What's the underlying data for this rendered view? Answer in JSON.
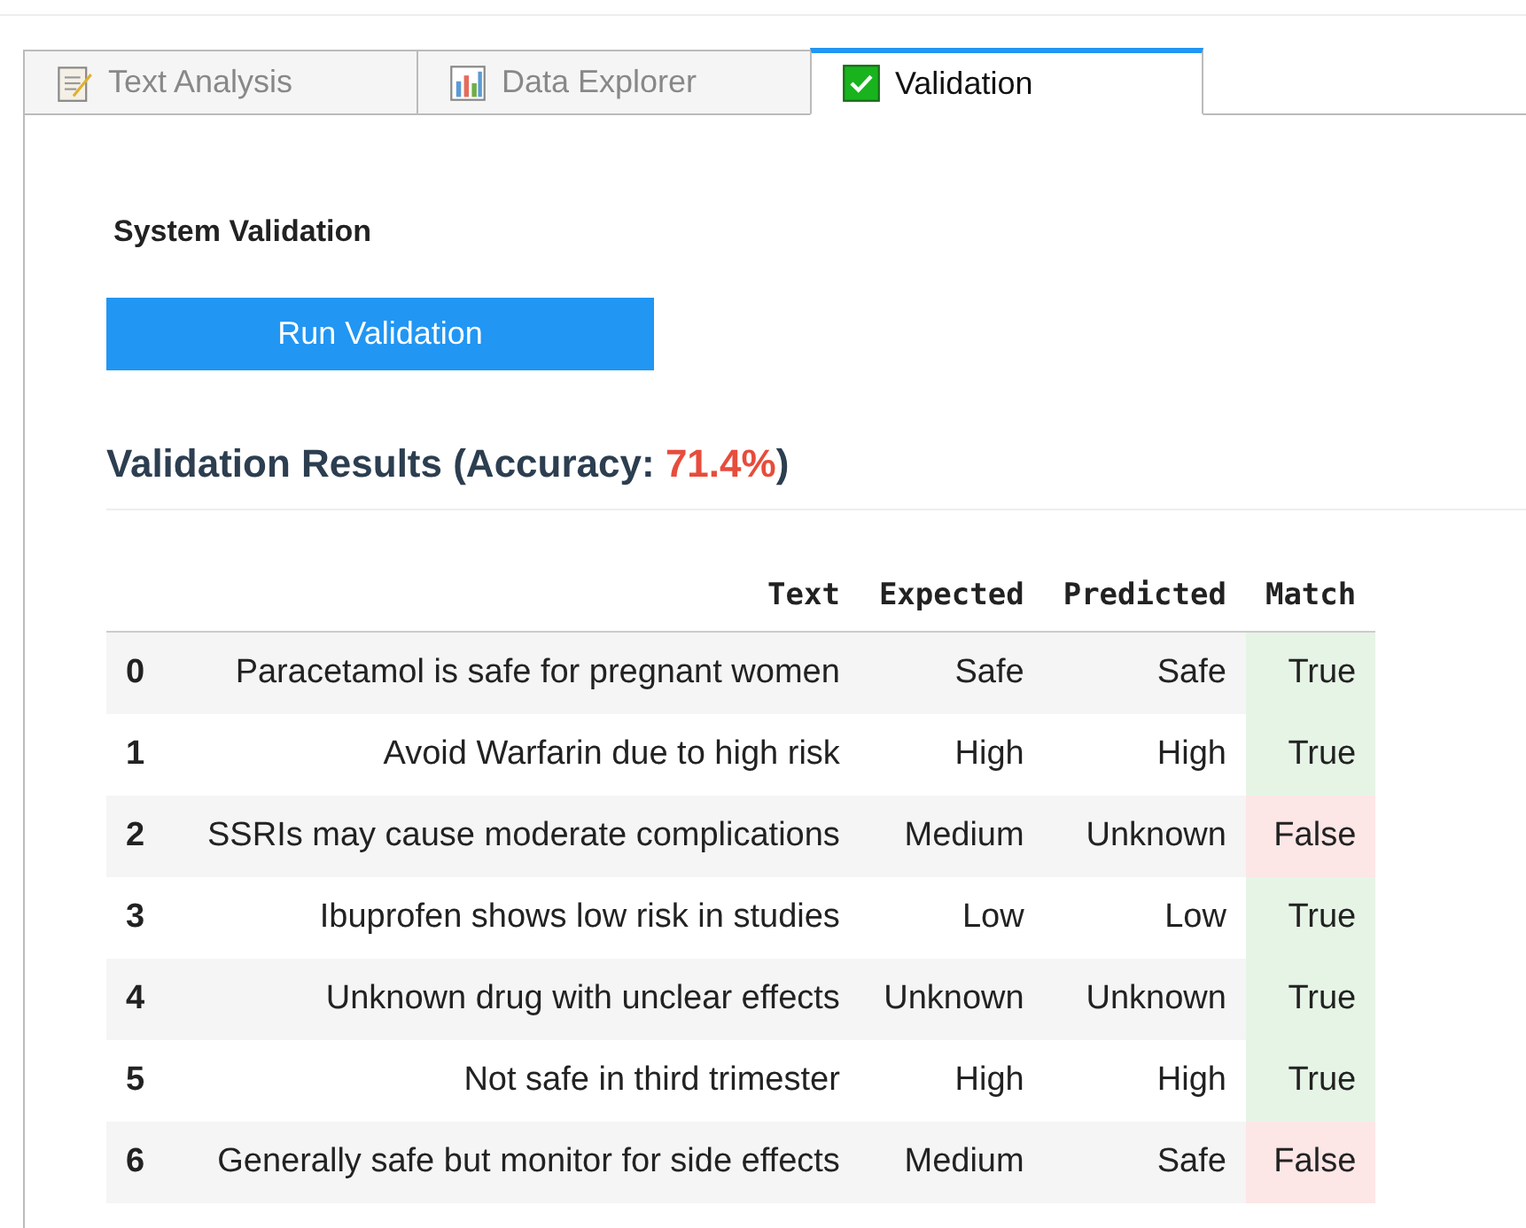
{
  "tabs": [
    {
      "label": "Text Analysis",
      "kind": "notepad",
      "selected": false
    },
    {
      "label": "Data Explorer",
      "kind": "chart",
      "selected": false
    },
    {
      "label": "Validation",
      "kind": "check",
      "selected": true
    }
  ],
  "section_title": "System Validation",
  "run_button": "Run Validation",
  "results_heading": {
    "prefix": "Validation Results (Accuracy: ",
    "accuracy": "71.4%",
    "suffix": ")"
  },
  "table": {
    "columns": [
      "Text",
      "Expected",
      "Predicted",
      "Match"
    ],
    "rows": [
      {
        "index": "0",
        "text": "Paracetamol is safe for pregnant women",
        "expected": "Safe",
        "predicted": "Safe",
        "match_text": "True",
        "match": true
      },
      {
        "index": "1",
        "text": "Avoid Warfarin due to high risk",
        "expected": "High",
        "predicted": "High",
        "match_text": "True",
        "match": true
      },
      {
        "index": "2",
        "text": "SSRIs may cause moderate complications",
        "expected": "Medium",
        "predicted": "Unknown",
        "match_text": "False",
        "match": false
      },
      {
        "index": "3",
        "text": "Ibuprofen shows low risk in studies",
        "expected": "Low",
        "predicted": "Low",
        "match_text": "True",
        "match": true
      },
      {
        "index": "4",
        "text": "Unknown drug with unclear effects",
        "expected": "Unknown",
        "predicted": "Unknown",
        "match_text": "True",
        "match": true
      },
      {
        "index": "5",
        "text": "Not safe in third trimester",
        "expected": "High",
        "predicted": "High",
        "match_text": "True",
        "match": true
      },
      {
        "index": "6",
        "text": "Generally safe but monitor for side effects",
        "expected": "Medium",
        "predicted": "Safe",
        "match_text": "False",
        "match": false
      }
    ]
  }
}
